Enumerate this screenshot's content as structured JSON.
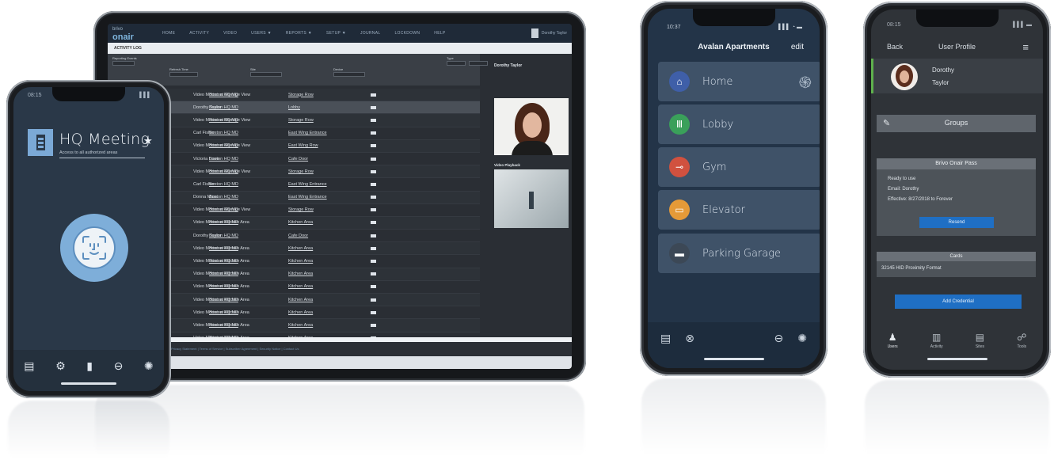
{
  "tablet": {
    "logo_small": "brivo",
    "logo": "onair",
    "nav": [
      "HOME",
      "ACTIVITY",
      "VIDEO",
      "USERS ▼",
      "REPORTS ▼",
      "SETUP ▼",
      "JOURNAL",
      "LOCKDOWN",
      "HELP"
    ],
    "user": "Dorothy Taylor",
    "page_title": "ACTIVITY LOG",
    "filter": {
      "label_search": "Reporting Events",
      "label_options": "Refresh Time",
      "label_date": "Site",
      "label_devices": "Device",
      "label_type": "Type"
    },
    "side_name": "Dorothy Taylor",
    "side_video_label": "Video Playback",
    "rows": [
      [
        "Video Motion at Storage View",
        "Boston HQ MD",
        "Storage Row"
      ],
      [
        "Dorothy Taylor",
        "Boston HQ MD",
        "Lobby"
      ],
      [
        "Video Motion at Storage View",
        "Boston HQ MD",
        "Storage Row"
      ],
      [
        "Carl Fisher",
        "Boston HQ MD",
        "East Wing Entrance"
      ],
      [
        "Video Motion at Storage View",
        "Boston HQ MD",
        "East Wing Row"
      ],
      [
        "Victoria Lowe",
        "Boston HQ MD",
        "Cafe Door"
      ],
      [
        "Video Motion at Storage View",
        "Boston HQ MD",
        "Storage Row"
      ],
      [
        "Carl Fisher",
        "Boston HQ MD",
        "East Wing Entrance"
      ],
      [
        "Donna Moss",
        "Boston HQ MD",
        "East Wing Entrance"
      ],
      [
        "Video Motion at Storage View",
        "Boston HQ MD",
        "Storage Row"
      ],
      [
        "Video Motion at Kitchen Area",
        "Boston HQ MD",
        "Kitchen Area"
      ],
      [
        "Dorothy Taylor",
        "Boston HQ MD",
        "Cafe Door"
      ],
      [
        "Video Motion at Kitchen Area",
        "Boston HQ MD",
        "Kitchen Area"
      ],
      [
        "Video Motion at Kitchen Area",
        "Boston HQ MD",
        "Kitchen Area"
      ],
      [
        "Video Motion at Kitchen Area",
        "Boston HQ MD",
        "Kitchen Area"
      ],
      [
        "Video Motion at Kitchen Area",
        "Boston HQ MD",
        "Kitchen Area"
      ],
      [
        "Video Motion at Kitchen Area",
        "Boston HQ MD",
        "Kitchen Area"
      ],
      [
        "Video Motion at Kitchen Area",
        "Boston HQ MD",
        "Kitchen Area"
      ],
      [
        "Video Motion at Kitchen Area",
        "Boston HQ MD",
        "Kitchen Area"
      ],
      [
        "Video Motion at Kitchen Area",
        "Boston HQ MD",
        "Kitchen Area"
      ]
    ],
    "footer_links": "Privacy Statement | Terms of Service | Subscriber Agreement | Security Notice | Contact Us"
  },
  "phone_left": {
    "time": "08:15",
    "signal": "▌▌▌",
    "title": "HQ Meeting",
    "subtitle": "Access to all authorized areas",
    "tabs": [
      "▤",
      "⚙",
      "▮",
      "⊖",
      "✺"
    ]
  },
  "phone_mid": {
    "time": "10:37",
    "signal": "▌▌▌ ◔ ▬",
    "title": "Avalan Apartments",
    "edit": "edit",
    "items": [
      {
        "label": "Home",
        "icon": "⌂",
        "color": "#3f5fa8"
      },
      {
        "label": "Lobby",
        "icon": "Ⅲ",
        "color": "#3aa05a"
      },
      {
        "label": "Gym",
        "icon": "⊸",
        "color": "#d1513f"
      },
      {
        "label": "Elevator",
        "icon": "▭",
        "color": "#e59a38"
      },
      {
        "label": "Parking Garage",
        "icon": "▬",
        "color": "#3c4856"
      }
    ],
    "tabs": [
      "▤",
      "⊗",
      "⊖",
      "✺"
    ]
  },
  "phone_right": {
    "time": "08:15",
    "signal": "▌▌▌ ▬",
    "back": "Back",
    "title": "User Profile",
    "menu": "≡",
    "first_name": "Dorothy",
    "last_name": "Taylor",
    "groups_label": "Groups",
    "card_title": "Brivo Onair Pass",
    "card_line1": "Ready to use",
    "card_line2": "Email: Dorothy",
    "card_line3": "Effective: 8/27/2018 to Forever",
    "card_button": "Resend",
    "cards_title": "Cards",
    "card_number": "32145 HID Proximity Format",
    "bottom_button": "Add Credential",
    "tabs": [
      {
        "icon": "♟",
        "label": "Users"
      },
      {
        "icon": "▥",
        "label": "Activity"
      },
      {
        "icon": "▤",
        "label": "Sites"
      },
      {
        "icon": "☍",
        "label": "Tools"
      }
    ]
  }
}
